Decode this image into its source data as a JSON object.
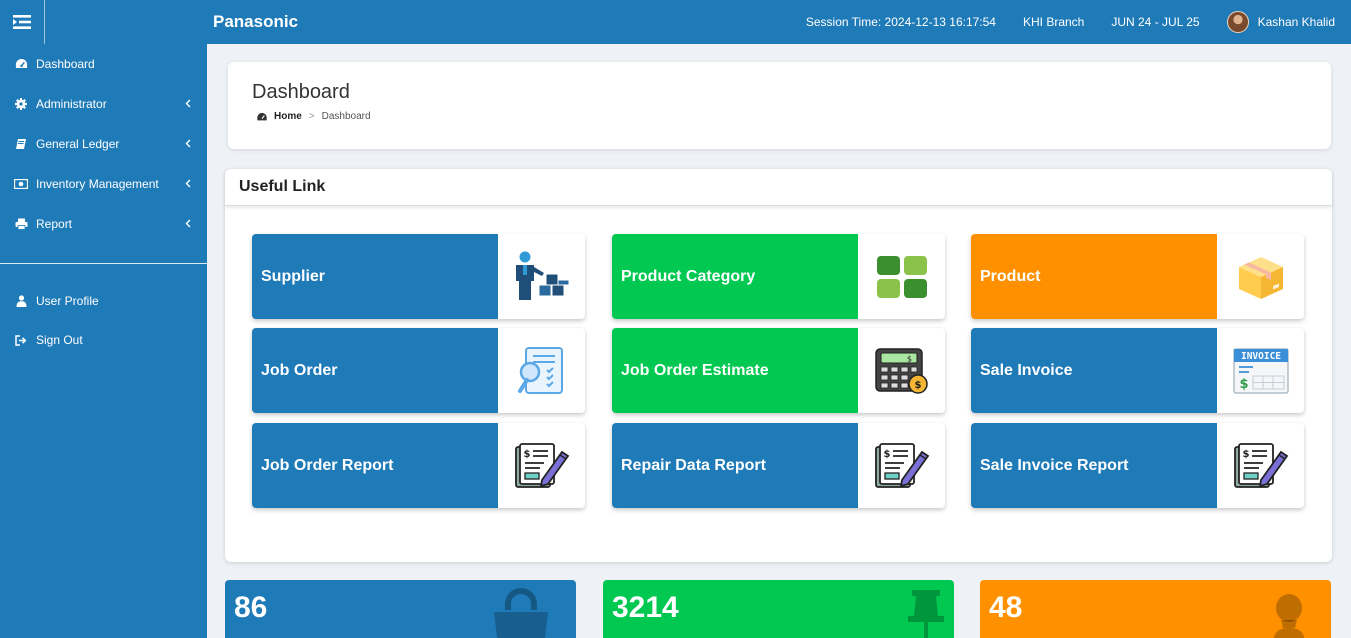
{
  "header": {
    "brand": "Panasonic",
    "session_time": "Session Time: 2024-12-13 16:17:54",
    "branch": "KHI Branch",
    "period": "JUN 24 - JUL 25",
    "user_name": "Kashan Khalid"
  },
  "sidebar": {
    "items": [
      {
        "label": "Dashboard",
        "icon": "dashboard-icon"
      },
      {
        "label": "Administrator",
        "icon": "gear-icon"
      },
      {
        "label": "General Ledger",
        "icon": "book-icon"
      },
      {
        "label": "Inventory Management",
        "icon": "money-icon"
      },
      {
        "label": "Report",
        "icon": "printer-icon"
      }
    ],
    "bottom_items": [
      {
        "label": "User Profile",
        "icon": "user-icon"
      },
      {
        "label": "Sign Out",
        "icon": "sign-out-icon"
      }
    ]
  },
  "page": {
    "title": "Dashboard",
    "breadcrumb_home": "Home",
    "breadcrumb_current": "Dashboard"
  },
  "useful_links": {
    "title": "Useful Link",
    "tiles": [
      {
        "label": "Supplier",
        "icon": "supplier-icon",
        "color": "#1f7ab8"
      },
      {
        "label": "Product Category",
        "icon": "category-grid-icon",
        "color": "#00c851"
      },
      {
        "label": "Product",
        "icon": "box-icon",
        "color": "#ff9100"
      },
      {
        "label": "Job Order",
        "icon": "document-search-icon",
        "color": "#1f7ab8"
      },
      {
        "label": "Job Order Estimate",
        "icon": "calculator-icon",
        "color": "#00c851"
      },
      {
        "label": "Sale Invoice",
        "icon": "invoice-icon",
        "color": "#1f7ab8"
      },
      {
        "label": "Job Order Report",
        "icon": "report-pen-icon",
        "color": "#1f7ab8"
      },
      {
        "label": "Repair Data Report",
        "icon": "report-pen-icon",
        "color": "#1f7ab8"
      },
      {
        "label": "Sale Invoice Report",
        "icon": "report-pen-icon",
        "color": "#1f7ab8"
      }
    ],
    "invoice_icon_text": "INVOICE"
  },
  "stats": [
    {
      "value": "86",
      "icon": "shopping-bag-icon",
      "color": "#1f7ab8"
    },
    {
      "value": "3214",
      "icon": "pushpin-icon",
      "color": "#00c851"
    },
    {
      "value": "48",
      "icon": "person-icon",
      "color": "#ff9100"
    }
  ]
}
